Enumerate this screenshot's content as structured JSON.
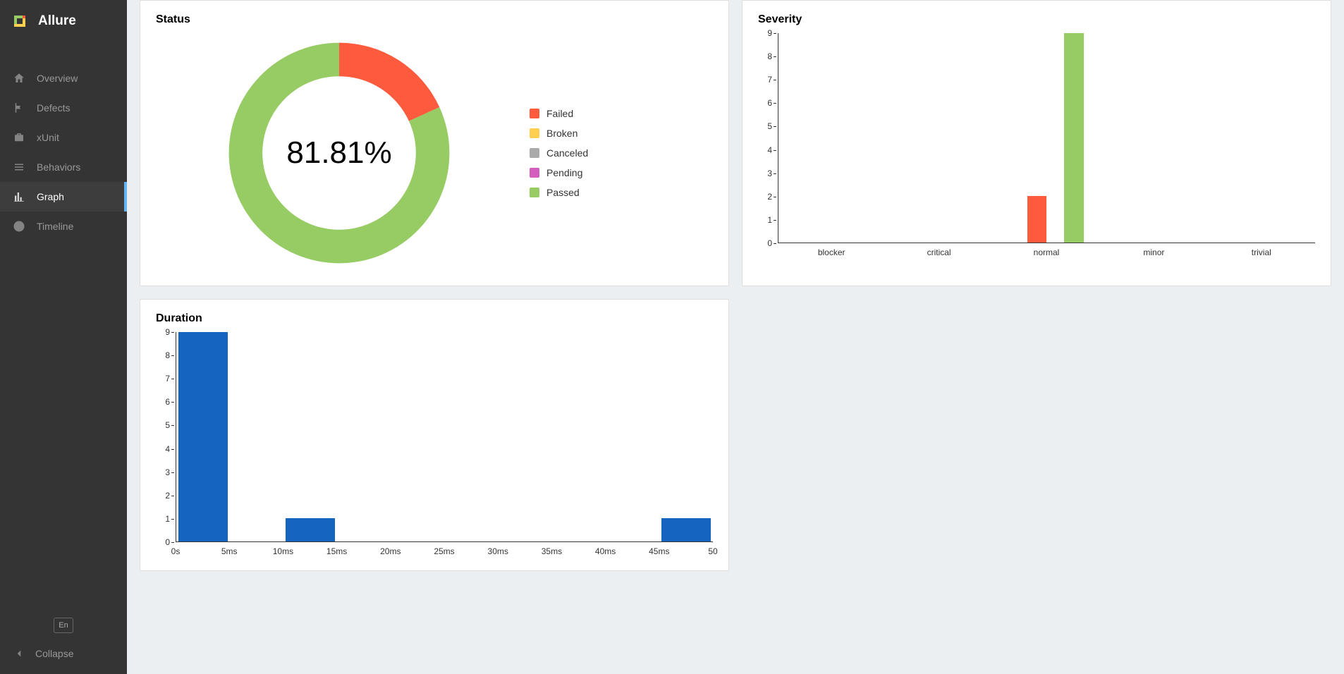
{
  "brand": {
    "name": "Allure"
  },
  "nav": {
    "items": [
      {
        "id": "overview",
        "label": "Overview"
      },
      {
        "id": "defects",
        "label": "Defects"
      },
      {
        "id": "xunit",
        "label": "xUnit"
      },
      {
        "id": "behaviors",
        "label": "Behaviors"
      },
      {
        "id": "graph",
        "label": "Graph"
      },
      {
        "id": "timeline",
        "label": "Timeline"
      }
    ],
    "active": "graph"
  },
  "footer": {
    "lang": "En",
    "collapse": "Collapse"
  },
  "panels": {
    "status": {
      "title": "Status",
      "center": "81.81%"
    },
    "severity": {
      "title": "Severity"
    },
    "duration": {
      "title": "Duration"
    }
  },
  "colors": {
    "failed": "#fd5a3e",
    "broken": "#ffd050",
    "canceled": "#aaaaaa",
    "pending": "#d35ebe",
    "passed": "#97cc64",
    "duration": "#1565c0"
  },
  "chart_data": [
    {
      "type": "pie",
      "title": "Status",
      "center_label": "81.81%",
      "series": [
        {
          "name": "Failed",
          "value": 2,
          "color": "#fd5a3e"
        },
        {
          "name": "Broken",
          "value": 0,
          "color": "#ffd050"
        },
        {
          "name": "Canceled",
          "value": 0,
          "color": "#aaaaaa"
        },
        {
          "name": "Pending",
          "value": 0,
          "color": "#d35ebe"
        },
        {
          "name": "Passed",
          "value": 9,
          "color": "#97cc64"
        }
      ],
      "legend": [
        "Failed",
        "Broken",
        "Canceled",
        "Pending",
        "Passed"
      ]
    },
    {
      "type": "bar",
      "title": "Severity",
      "categories": [
        "blocker",
        "critical",
        "normal",
        "minor",
        "trivial"
      ],
      "series": [
        {
          "name": "failed",
          "color": "#fd5a3e",
          "values": [
            0,
            0,
            2,
            0,
            0
          ]
        },
        {
          "name": "passed",
          "color": "#97cc64",
          "values": [
            0,
            0,
            9,
            0,
            0
          ]
        }
      ],
      "ylim": [
        0,
        9
      ],
      "yticks": [
        0,
        1,
        2,
        3,
        4,
        5,
        6,
        7,
        8,
        9
      ]
    },
    {
      "type": "bar",
      "title": "Duration",
      "x_ticks": [
        "0s",
        "5ms",
        "10ms",
        "15ms",
        "20ms",
        "25ms",
        "30ms",
        "35ms",
        "40ms",
        "45ms",
        "50"
      ],
      "values": [
        9,
        0,
        1,
        0,
        0,
        0,
        0,
        0,
        0,
        1
      ],
      "color": "#1565c0",
      "ylim": [
        0,
        9
      ],
      "yticks": [
        0,
        1,
        2,
        3,
        4,
        5,
        6,
        7,
        8,
        9
      ]
    }
  ]
}
